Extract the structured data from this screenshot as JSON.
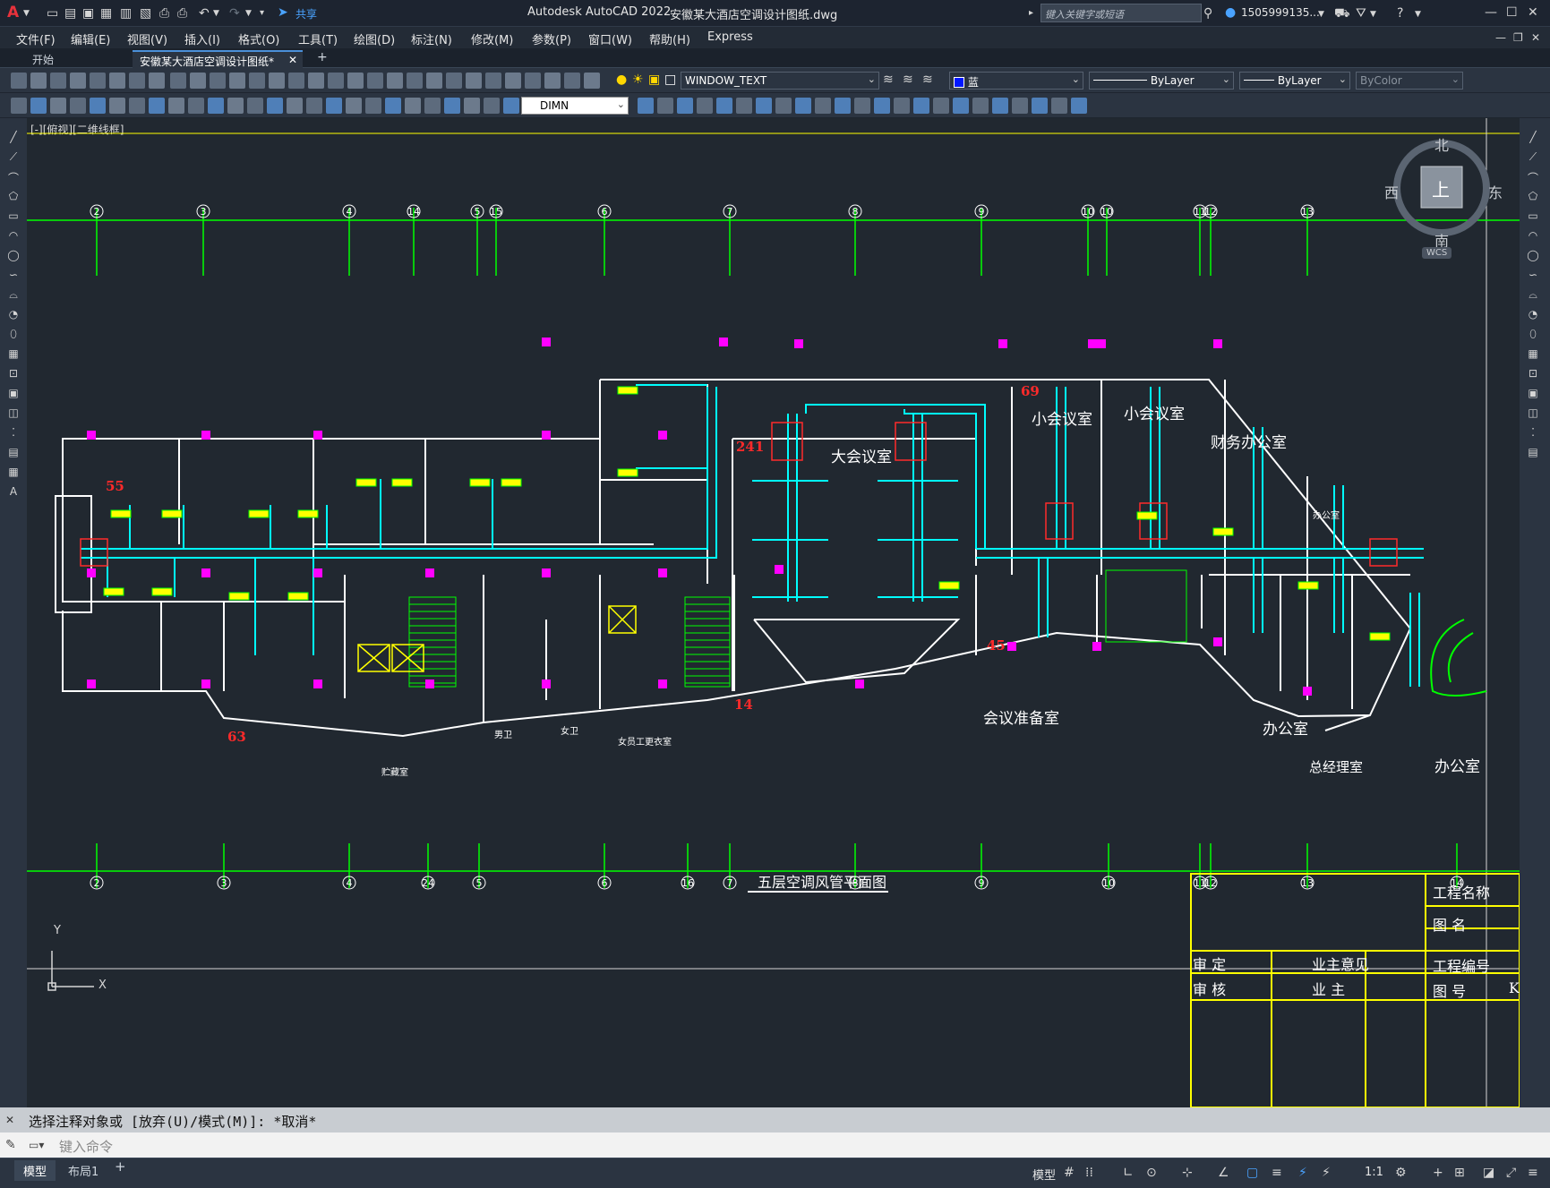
{
  "titlebar": {
    "app_title": "Autodesk AutoCAD 2022",
    "file_name": "安徽某大酒店空调设计图纸.dwg",
    "search_placeholder": "键入关键字或短语",
    "user": "1505999135...",
    "share_label": "共享"
  },
  "menu": [
    "文件(F)",
    "编辑(E)",
    "视图(V)",
    "插入(I)",
    "格式(O)",
    "工具(T)",
    "绘图(D)",
    "标注(N)",
    "修改(M)",
    "参数(P)",
    "窗口(W)",
    "帮助(H)",
    "Express"
  ],
  "tabs": {
    "start": "开始",
    "active": "安徽某大酒店空调设计图纸*",
    "add": "+"
  },
  "properties": {
    "layer": "WINDOW_TEXT",
    "color": "蓝",
    "linetype": "ByLayer",
    "lineweight": "ByLayer",
    "plotstyle": "ByColor",
    "dimstyle": "DIMN"
  },
  "viewcube": {
    "north": "北",
    "south": "南",
    "east": "东",
    "west": "西",
    "face": "上",
    "wcs": "WCS"
  },
  "viewport_label": "[-][俯视][二维线框]",
  "axes_top": [
    "2",
    "3",
    "4",
    "14",
    "5",
    "15",
    "6",
    "7",
    "8",
    "9",
    "10",
    "10",
    "11",
    "12",
    "13"
  ],
  "axes_bottom": [
    "2",
    "3",
    "4",
    "24",
    "5",
    "6",
    "16",
    "7",
    "8",
    "9",
    "10",
    "11",
    "12",
    "13",
    "14"
  ],
  "rooms": {
    "small_meeting_1": "小会议室",
    "small_meeting_2": "小会议室",
    "big_meeting": "大会议室",
    "finance": "财务办公室",
    "office_a": "办公室",
    "office_b": "办公室",
    "office_c": "办公室",
    "gm_office": "总经理室",
    "prep": "会议准备室",
    "male_wc": "男卫",
    "female_wc": "女卫",
    "staff": "女员工更衣室",
    "lounge": "贮藏室"
  },
  "room_numbers": [
    "55",
    "241",
    "69",
    "63",
    "45",
    "14"
  ],
  "drawing_title": "五层空调风管平面图",
  "title_block": {
    "project_name": "工程名称",
    "drawing_name": "图  名",
    "project_no": "工程编号",
    "drawing_no": "图  号",
    "review": "审  定",
    "check": "审  核",
    "owner_opinion": "业主意见",
    "owner": "业  主",
    "k": "K"
  },
  "ucs": {
    "y": "Y",
    "x": "X"
  },
  "command": {
    "history": "选择注释对象或 [放弃(U)/模式(M)]: *取消*",
    "placeholder": "键入命令"
  },
  "status": {
    "model_tab": "模型",
    "layout_tab": "布局1",
    "model_btn": "模型",
    "scale": "1:1"
  },
  "colors": {
    "grid_green": "#00ff00",
    "wall_white": "#ffffff",
    "duct_cyan": "#00ffff",
    "marker_magenta": "#ff00ff",
    "red": "#ff2a2a",
    "yellow": "#ffff00",
    "bg": "#212830"
  }
}
